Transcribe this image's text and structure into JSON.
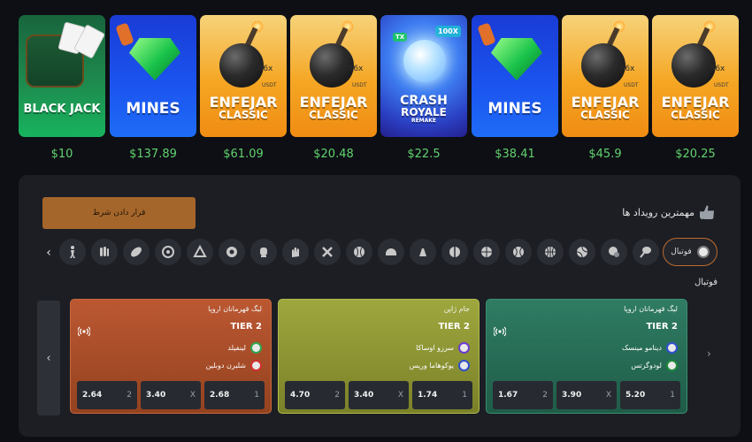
{
  "games": [
    {
      "name": "BLACK JACK",
      "amount": "$10"
    },
    {
      "name": "MINES",
      "amount": "$137.89"
    },
    {
      "name1": "ENFEJAR",
      "name2": "CLASSIC",
      "mult": "2.86x",
      "unit": "USDT",
      "amount": "$61.09"
    },
    {
      "name1": "ENFEJAR",
      "name2": "CLASSIC",
      "mult": "2.86x",
      "unit": "USDT",
      "amount": "$20.48"
    },
    {
      "name1": "CRASH",
      "name2": "ROYALE",
      "name3": "REMAKE",
      "tag1": "100X",
      "tag2": "TX",
      "amount": "$22.5"
    },
    {
      "name": "MINES",
      "amount": "$38.41"
    },
    {
      "name1": "ENFEJAR",
      "name2": "CLASSIC",
      "mult": "2.86x",
      "unit": "USDT",
      "amount": "$45.9"
    },
    {
      "name1": "ENFEJAR",
      "name2": "CLASSIC",
      "mult": "2.86x",
      "unit": "USDT",
      "amount": "$20.25"
    }
  ],
  "bets": {
    "place_bet": "قرار دادن شرط",
    "events_title": "مهمترین رویداد ها",
    "active_sport": "فوتبال",
    "section": "فوتبال",
    "sports": [
      "futsal",
      "volleyball",
      "tennis",
      "basketball",
      "handball",
      "table-tennis",
      "badminton",
      "ice-hockey",
      "baseball",
      "cricket",
      "rugby",
      "boxing",
      "water-polo",
      "snooker",
      "darts",
      "american-football",
      "cycling",
      "other"
    ]
  },
  "matches": [
    {
      "league": "لیگ قهرمانان اروپا",
      "tier": "TIER 2",
      "team1": "دینامو مینسک",
      "team2": "لودوگرتس",
      "odds": [
        {
          "k": "1",
          "v": "5.20"
        },
        {
          "k": "X",
          "v": "3.90"
        },
        {
          "k": "2",
          "v": "1.67"
        }
      ]
    },
    {
      "league": "جام ژاپن",
      "tier": "TIER 2",
      "team1": "سرزو اوساکا",
      "team2": "یوکوهاما وریس",
      "odds": [
        {
          "k": "1",
          "v": "1.74"
        },
        {
          "k": "X",
          "v": "3.40"
        },
        {
          "k": "2",
          "v": "4.70"
        }
      ]
    },
    {
      "league": "لیگ قهرمانان اروپا",
      "tier": "TIER 2",
      "team1": "لینفیلد",
      "team2": "شلبرن دوبلین",
      "odds": [
        {
          "k": "1",
          "v": "2.68"
        },
        {
          "k": "X",
          "v": "3.40"
        },
        {
          "k": "2",
          "v": "2.64"
        }
      ]
    }
  ],
  "colors": {
    "amount": "#62d26f",
    "accent": "#c06a2b",
    "place_bet": "#a5662b"
  }
}
